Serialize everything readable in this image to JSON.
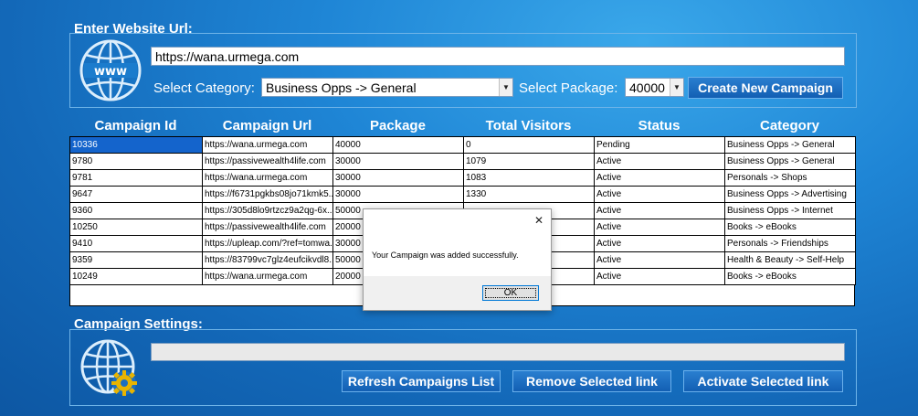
{
  "top": {
    "section_title": "Enter Website Url:",
    "url_value": "https://wana.urmega.com",
    "category_label": "Select Category:",
    "category_selected": "Business Opps -> General",
    "package_label": "Select Package:",
    "package_selected": "40000",
    "create_button": "Create New Campaign"
  },
  "table": {
    "headers": [
      "Campaign Id",
      "Campaign Url",
      "Package",
      "Total Visitors",
      "Status",
      "Category"
    ],
    "rows": [
      [
        "10336",
        "https://wana.urmega.com",
        "40000",
        "0",
        "Pending",
        "Business Opps -> General"
      ],
      [
        "9780",
        "https://passivewealth4life.com",
        "30000",
        "1079",
        "Active",
        "Business Opps -> General"
      ],
      [
        "9781",
        "https://wana.urmega.com",
        "30000",
        "1083",
        "Active",
        "Personals -> Shops"
      ],
      [
        "9647",
        "https://f6731pgkbs08jo71kmk5...",
        "30000",
        "1330",
        "Active",
        "Business Opps -> Advertising"
      ],
      [
        "9360",
        "https://305d8lo9rtzcz9a2qg-6x...",
        "50000",
        "",
        "Active",
        "Business Opps -> Internet"
      ],
      [
        "10250",
        "https://passivewealth4life.com",
        "20000",
        "",
        "Active",
        "Books -> eBooks"
      ],
      [
        "9410",
        "https://upleap.com/?ref=tomwa...",
        "30000",
        "",
        "Active",
        "Personals -> Friendships"
      ],
      [
        "9359",
        "https://83799vc7glz4eufcikvdl8...",
        "50000",
        "",
        "Active",
        "Health & Beauty -> Self-Help"
      ],
      [
        "10249",
        "https://wana.urmega.com",
        "20000",
        "",
        "Active",
        "Books -> eBooks"
      ]
    ]
  },
  "settings": {
    "section_title": "Campaign Settings:",
    "refresh_button": "Refresh Campaigns List",
    "remove_button": "Remove Selected link",
    "activate_button": "Activate Selected link"
  },
  "dialog": {
    "message": "Your Campaign was added successfully.",
    "ok_label": "OK",
    "close_glyph": "✕"
  },
  "icons": {
    "top_icon": "www-globe-icon",
    "settings_icon": "globe-gear-icon"
  }
}
